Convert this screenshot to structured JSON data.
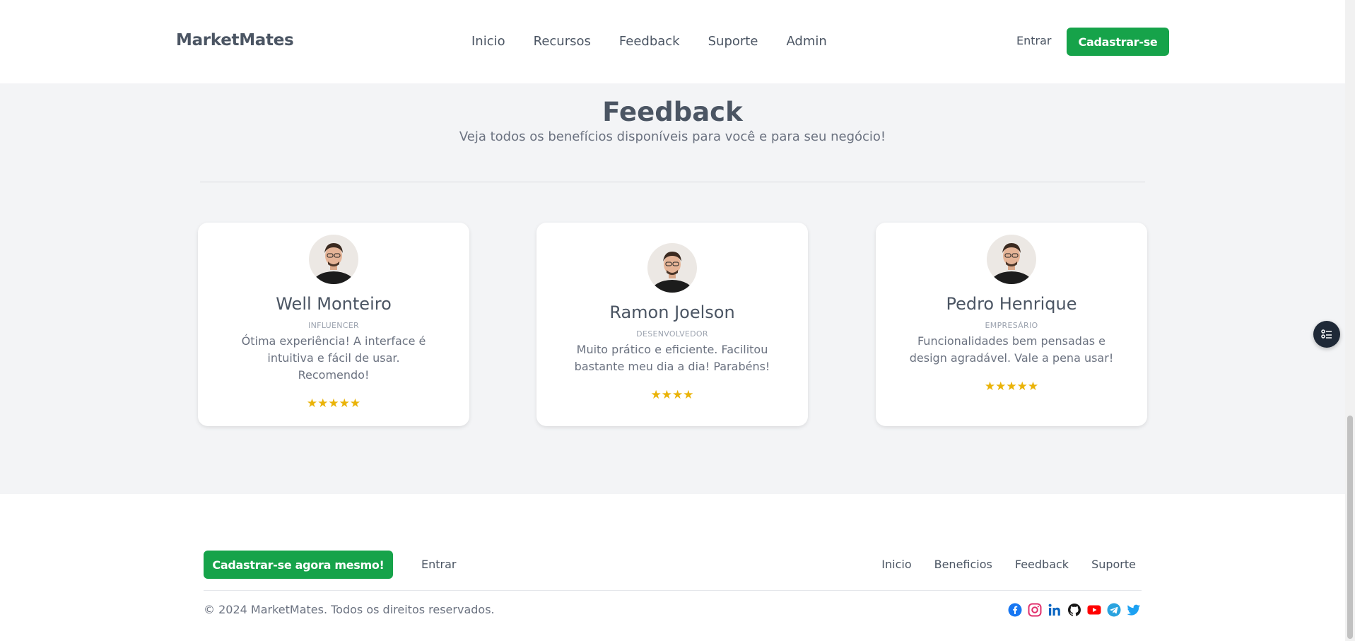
{
  "header": {
    "brand": "MarketMates",
    "nav": [
      "Inicio",
      "Recursos",
      "Feedback",
      "Suporte",
      "Admin"
    ],
    "login_label": "Entrar",
    "signup_label": "Cadastrar-se"
  },
  "feedback": {
    "title": "Feedback",
    "subtitle": "Veja todos os benefícios disponíveis para você e para seu negócio!",
    "cards": [
      {
        "name": "Well Monteiro",
        "role": "INFLUENCER",
        "text": "Ótima experiência! A interface é intuitiva e fácil de usar. Recomendo!",
        "stars": "★★★★★",
        "rating": 5
      },
      {
        "name": "Ramon Joelson",
        "role": "DESENVOLVEDOR",
        "text": "Muito prático e eficiente. Facilitou bastante meu dia a dia! Parabéns!",
        "stars": "★★★★",
        "rating": 4
      },
      {
        "name": "Pedro Henrique",
        "role": "EMPRESÁRIO",
        "text": "Funcionalidades bem pensadas e design agradável. Vale a pena usar!",
        "stars": "★★★★★",
        "rating": 5
      }
    ]
  },
  "footer": {
    "cta_label": "Cadastrar-se agora mesmo!",
    "login_label": "Entrar",
    "nav": [
      "Inicio",
      "Beneficios",
      "Feedback",
      "Suporte"
    ],
    "copyright": "© 2024 MarketMates. Todos os direitos reservados.",
    "socials": [
      "facebook-icon",
      "instagram-icon",
      "linkedin-icon",
      "github-icon",
      "youtube-icon",
      "telegram-icon",
      "twitter-icon"
    ]
  },
  "colors": {
    "accent": "#16a34a",
    "star": "#eab308",
    "text": "#4b5563",
    "background": "#f3f4f6"
  }
}
